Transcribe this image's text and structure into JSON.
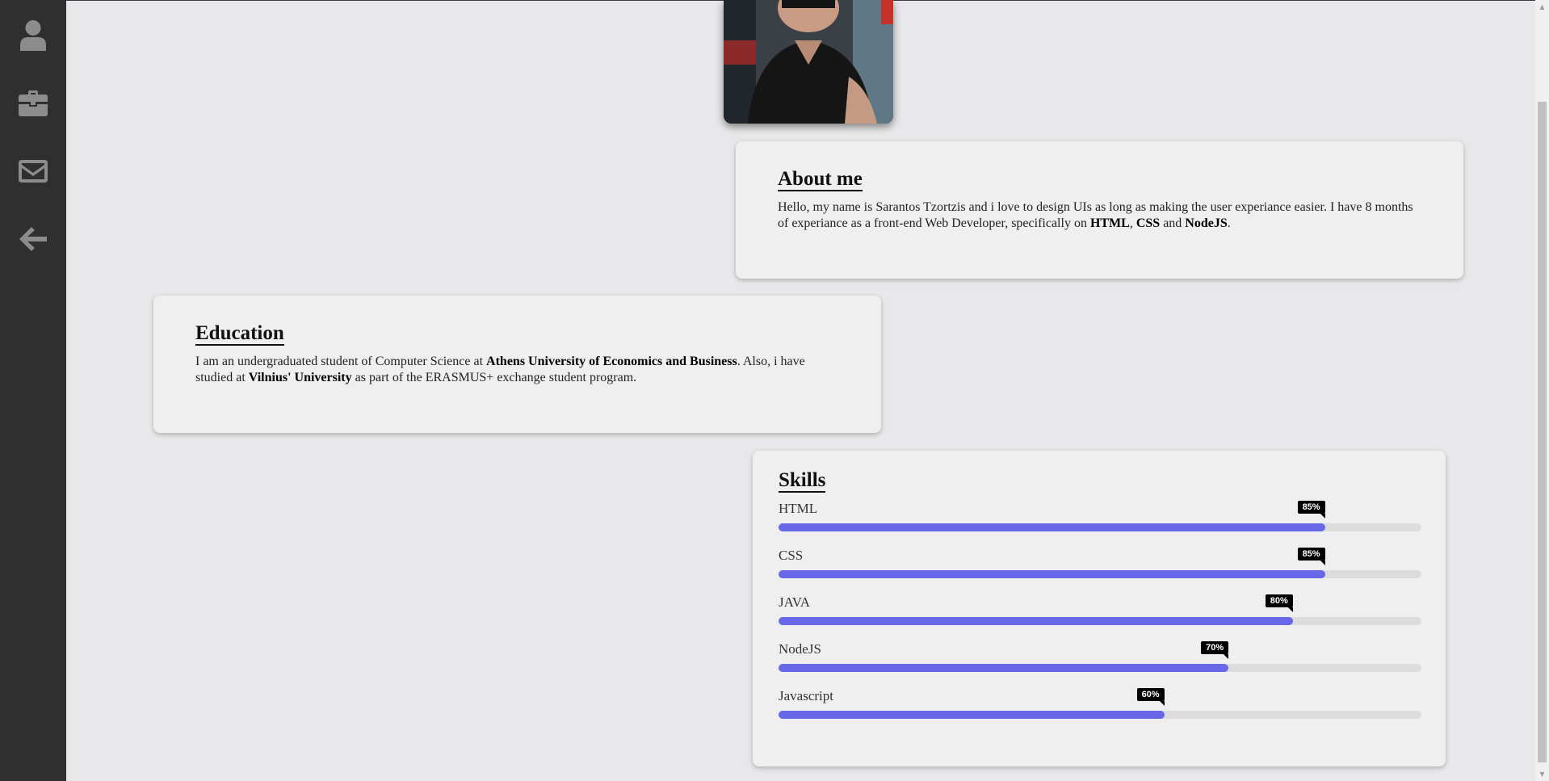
{
  "sidebar": {
    "items": [
      {
        "icon": "user-icon"
      },
      {
        "icon": "briefcase-icon"
      },
      {
        "icon": "envelope-icon"
      },
      {
        "icon": "arrow-left-icon"
      }
    ]
  },
  "about": {
    "title": "About me",
    "text_1": "Hello, my name is Sarantos Tzortzis and i love to design UIs as long as making the user experiance easier. I have 8 months of experiance as a front-end Web Developer, specifically on ",
    "html": "HTML",
    "sep_1": ", ",
    "css": "CSS",
    "sep_2": " and ",
    "nodejs": "NodeJS",
    "end": "."
  },
  "education": {
    "title": "Education",
    "text_1": "I am an undergraduated student of Computer Science at ",
    "university": "Athens University of Economics and Business",
    "text_2": ". Also, i have studied at ",
    "vilnius": "Vilnius' University",
    "text_3": " as part of the ERASMUS+ exchange student program."
  },
  "skills": {
    "title": "Skills",
    "items": [
      {
        "name": "HTML",
        "percent": 85,
        "label": "85%"
      },
      {
        "name": "CSS",
        "percent": 85,
        "label": "85%"
      },
      {
        "name": "JAVA",
        "percent": 80,
        "label": "80%"
      },
      {
        "name": "NodeJS",
        "percent": 70,
        "label": "70%"
      },
      {
        "name": "Javascript",
        "percent": 60,
        "label": "60%"
      }
    ]
  },
  "colors": {
    "sidebar_bg": "#2f2f2f",
    "icon": "#8c8c8c",
    "bar_fill": "#6767e8",
    "bar_track": "#dcdcdc",
    "page_bg": "#e8e8ea"
  }
}
